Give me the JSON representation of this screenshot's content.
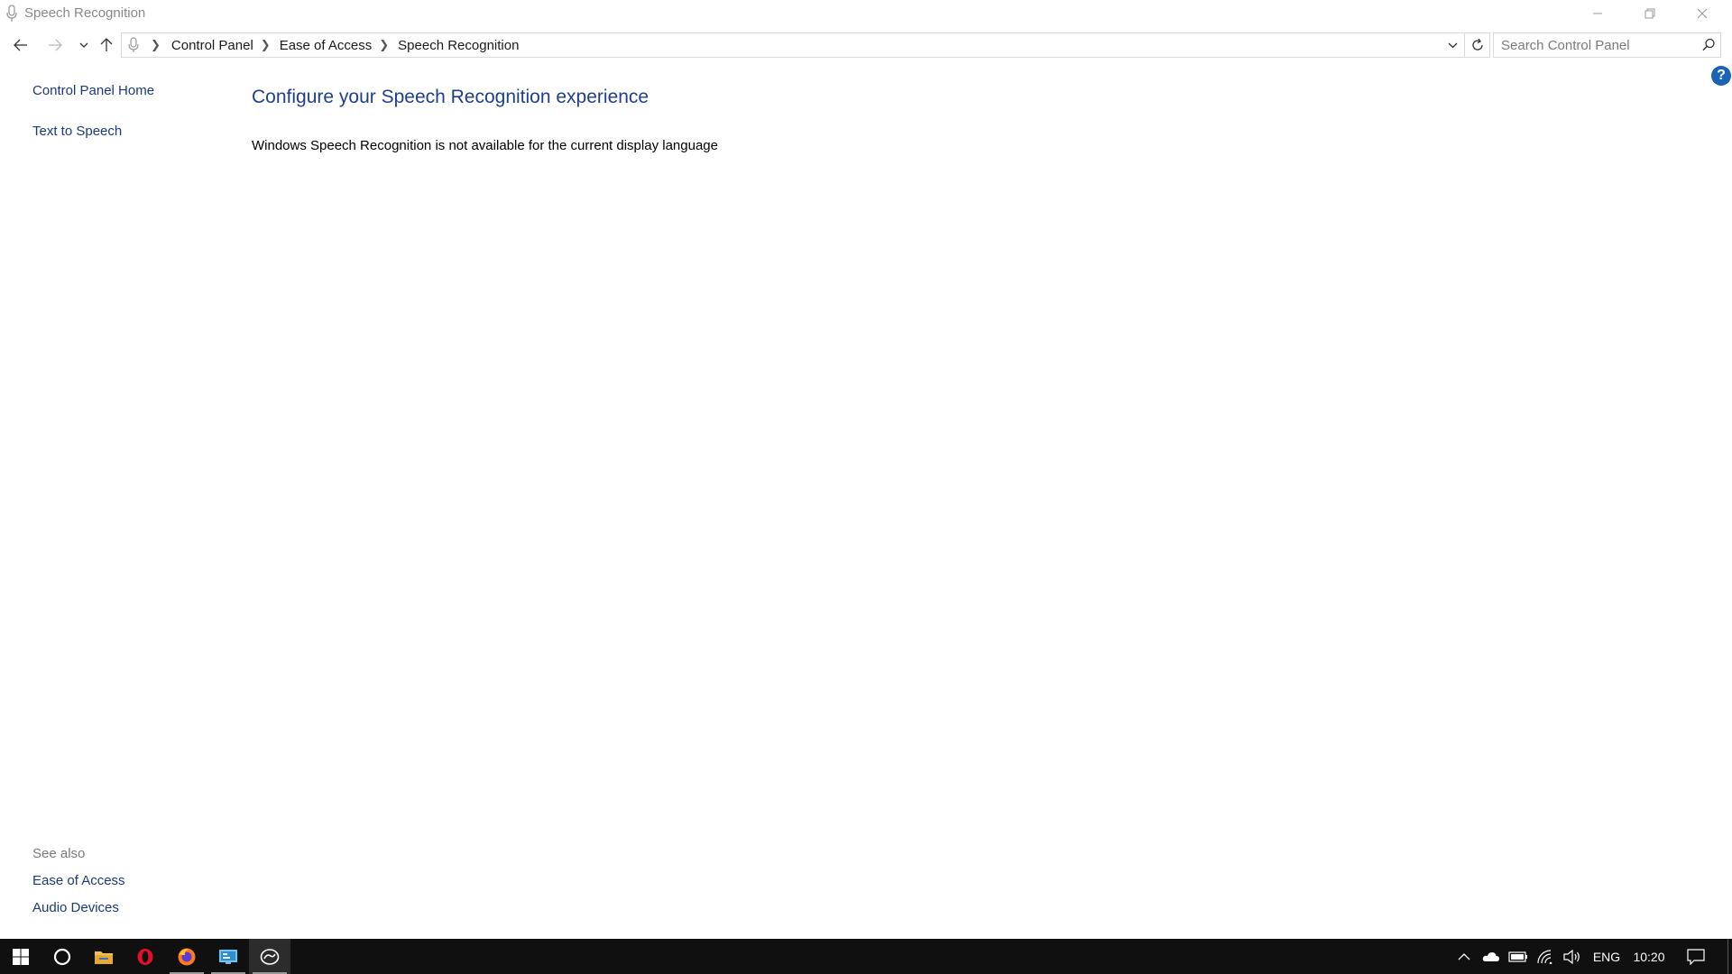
{
  "window": {
    "title": "Speech Recognition"
  },
  "navigation": {
    "breadcrumbs": [
      "Control Panel",
      "Ease of Access",
      "Speech Recognition"
    ],
    "search_placeholder": "Search Control Panel"
  },
  "left_pane": {
    "links": [
      "Control Panel Home",
      "Text to Speech"
    ],
    "see_also_title": "See also",
    "see_also_links": [
      "Ease of Access",
      "Audio Devices"
    ]
  },
  "main": {
    "heading": "Configure your Speech Recognition experience",
    "message": "Windows Speech Recognition is not available for the current display language"
  },
  "help": {
    "label": "?"
  },
  "taskbar": {
    "apps": [
      "start-icon",
      "cortana-icon",
      "file-explorer-icon",
      "opera-icon",
      "firefox-icon",
      "control-panel-icon",
      "speech-recognition-icon"
    ],
    "language": "ENG",
    "clock": "10:20"
  },
  "colors": {
    "link": "#1a3a7a",
    "heading": "#1e3f8e",
    "help_badge": "#1b62b9",
    "taskbar": "#101010"
  }
}
